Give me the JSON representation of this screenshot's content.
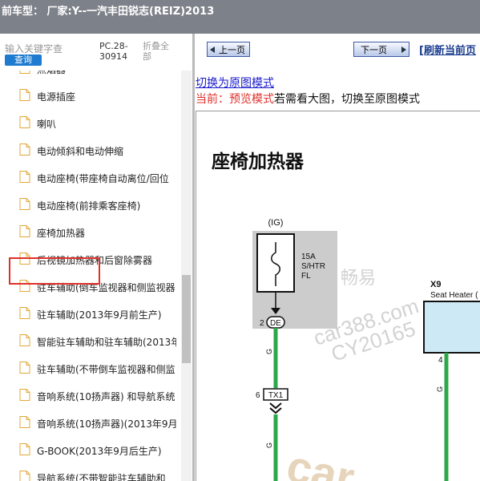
{
  "window": {
    "title": "前车型： 厂家:Y--一汽丰田锐志(REIZ)2013"
  },
  "sidebar": {
    "search_placeholder": "输入关键字查",
    "search_button": "查询",
    "code": "PC.28-30914",
    "collapse_all": "折叠全部",
    "items": [
      {
        "label": "点烟器"
      },
      {
        "label": "电源插座"
      },
      {
        "label": "喇叭"
      },
      {
        "label": "电动倾斜和电动伸缩"
      },
      {
        "label": "电动座椅(带座椅自动离位/回位"
      },
      {
        "label": "电动座椅(前排乘客座椅)"
      },
      {
        "label": "座椅加热器"
      },
      {
        "label": "后视镜加热器和后窗除雾器"
      },
      {
        "label": "驻车辅助(倒车监视器和侧监视器"
      },
      {
        "label": "驻车辅助(2013年9月前生产)"
      },
      {
        "label": "智能驻车辅助和驻车辅助(2013年"
      },
      {
        "label": "驻车辅助(不带倒车监视器和侧监"
      },
      {
        "label": "音响系统(10扬声器) 和导航系统"
      },
      {
        "label": "音响系统(10扬声器)(2013年9月"
      },
      {
        "label": "G-BOOK(2013年9月后生产)"
      },
      {
        "label": "导航系统(不带智能驻车辅助和"
      }
    ],
    "highlighted_index": 6
  },
  "toolbar": {
    "prev_label": "上一页",
    "next_label": "下一页",
    "refresh_label": "[刷新当前页"
  },
  "content": {
    "switch_link": "切换为原图模式",
    "status_label": "当前：预览模式",
    "status_hint": "若需看大图，切换至原图模式",
    "doc_title": "座椅加热器",
    "diagram": {
      "ig": "(IG)",
      "fuse_amp": "15A",
      "fuse_name": "S/HTR",
      "fuse_type": "FL",
      "pin_2": "2",
      "connector_de": "DE",
      "wire_g1": "G",
      "pin_6": "6",
      "connector_tx1": "TX1",
      "wire_g2": "G",
      "x9": "X9",
      "seat_heater": "Seat Heater (",
      "pin_4": "4",
      "wire_g3": "G",
      "watermark_1": "畅易",
      "watermark_2": "car388.com",
      "watermark_3": "CY20165",
      "watermark_logo": "car"
    }
  },
  "colors": {
    "titlebar": "#7d8189",
    "search_button": "#1e7bd0",
    "highlight": "#e0302a",
    "wire": "#2ca84a",
    "fuse_bg": "#cccccc",
    "connector_box": "#cde9f6"
  }
}
